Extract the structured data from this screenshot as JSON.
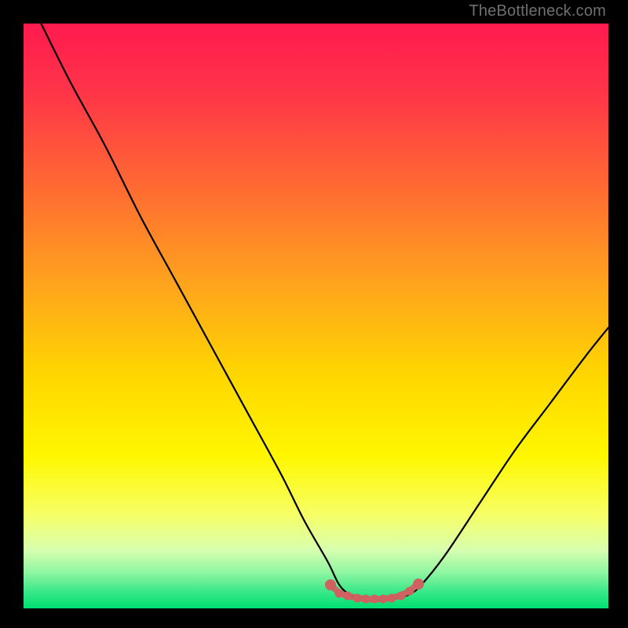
{
  "attribution": "TheBottleneck.com",
  "chart_data": {
    "type": "line",
    "title": "",
    "xlabel": "",
    "ylabel": "",
    "xlim": [
      0,
      100
    ],
    "ylim": [
      0,
      100
    ],
    "grid": false,
    "legend": false,
    "notes": "Background is a vertical gradient from red (top) through orange/yellow to green (bottom). A black V-shaped curve descends steeply from top-left to a flat trough near x≈54–66 at y≈2, then rises toward the right edge reaching y≈48 at x=100. Small salmon-colored dots highlight the trough region.",
    "gradient_stops": [
      {
        "pos": 0.0,
        "color": "#ff1a4e"
      },
      {
        "pos": 0.12,
        "color": "#ff3548"
      },
      {
        "pos": 0.28,
        "color": "#ff6a32"
      },
      {
        "pos": 0.44,
        "color": "#ffa21e"
      },
      {
        "pos": 0.6,
        "color": "#ffd600"
      },
      {
        "pos": 0.74,
        "color": "#fff700"
      },
      {
        "pos": 0.84,
        "color": "#f6ff66"
      },
      {
        "pos": 0.9,
        "color": "#d8ffb0"
      },
      {
        "pos": 0.94,
        "color": "#8cf5a0"
      },
      {
        "pos": 0.97,
        "color": "#3ce88a"
      },
      {
        "pos": 1.0,
        "color": "#00df72"
      }
    ],
    "series": [
      {
        "name": "bottleneck-curve",
        "x": [
          3,
          8,
          14,
          20,
          26,
          32,
          38,
          44,
          48,
          52,
          54,
          56,
          58,
          60,
          62,
          64,
          66,
          68,
          72,
          78,
          84,
          90,
          96,
          100
        ],
        "y": [
          100,
          90,
          79,
          67,
          56,
          45,
          34,
          23,
          15,
          8,
          4,
          2.2,
          1.8,
          1.6,
          1.6,
          1.8,
          2.4,
          4,
          9,
          18,
          27,
          35,
          43,
          48
        ]
      }
    ],
    "trough_markers": {
      "color": "#cf6160",
      "points": [
        {
          "x": 52.5,
          "y": 4.0
        },
        {
          "x": 54.0,
          "y": 2.6
        },
        {
          "x": 55.5,
          "y": 2.1
        },
        {
          "x": 57.0,
          "y": 1.8
        },
        {
          "x": 58.5,
          "y": 1.6
        },
        {
          "x": 60.0,
          "y": 1.6
        },
        {
          "x": 61.5,
          "y": 1.6
        },
        {
          "x": 63.0,
          "y": 1.8
        },
        {
          "x": 64.5,
          "y": 2.2
        },
        {
          "x": 66.0,
          "y": 3.0
        },
        {
          "x": 67.5,
          "y": 4.2
        }
      ]
    }
  }
}
